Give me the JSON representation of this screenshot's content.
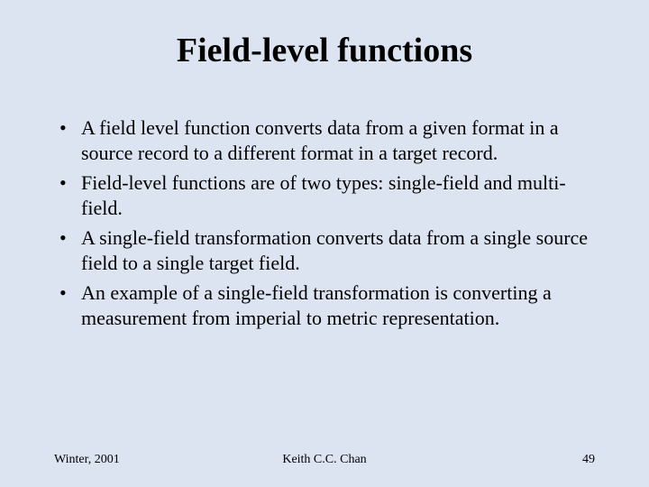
{
  "title": "Field-level functions",
  "bullets": [
    "A field level function converts data from a given format in a source record to a different format in a target record.",
    "Field-level functions are of two types: single-field and multi-field.",
    "A single-field transformation converts data from a single source field to a single target field.",
    "An example of a single-field transformation is converting a measurement from imperial to metric representation."
  ],
  "footer": {
    "left": "Winter, 2001",
    "center": "Keith C.C. Chan",
    "right": "49"
  }
}
